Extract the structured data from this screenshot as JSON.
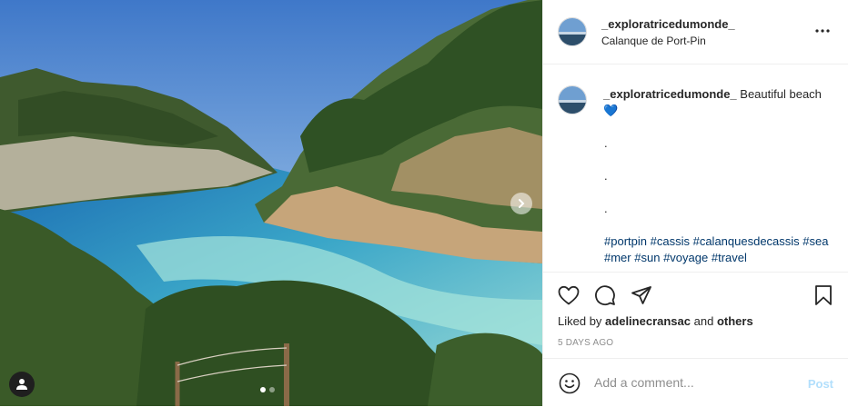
{
  "post": {
    "username": "_exploratricedumonde_",
    "location": "Calanque de Port-Pin",
    "caption_text": "Beautiful beach",
    "caption_emoji": "💙",
    "caption_dots": [
      ".",
      ".",
      "."
    ],
    "hashtags": [
      "#portpin",
      "#cassis",
      "#calanquesdecassis",
      "#sea",
      "#mer",
      "#sun",
      "#voyage",
      "#travel"
    ],
    "liked_by_prefix": "Liked by",
    "liked_by_user": "adelinecransac",
    "liked_by_and": "and",
    "liked_by_others": "others",
    "time_ago": "5 DAYS AGO"
  },
  "carousel": {
    "total": 2,
    "current": 1
  },
  "comment": {
    "placeholder": "Add a comment...",
    "post_label": "Post"
  },
  "icons": {
    "header_more": "more-options-icon",
    "like": "heart-icon",
    "comment": "comment-icon",
    "share": "paper-plane-icon",
    "save": "bookmark-icon",
    "emoji": "smiley-icon",
    "next": "chevron-right-icon",
    "user_tag": "user-tag-icon"
  },
  "colors": {
    "hashtag": "#00376b",
    "post_button": "#b2dffc",
    "heart": "#3897f0"
  }
}
